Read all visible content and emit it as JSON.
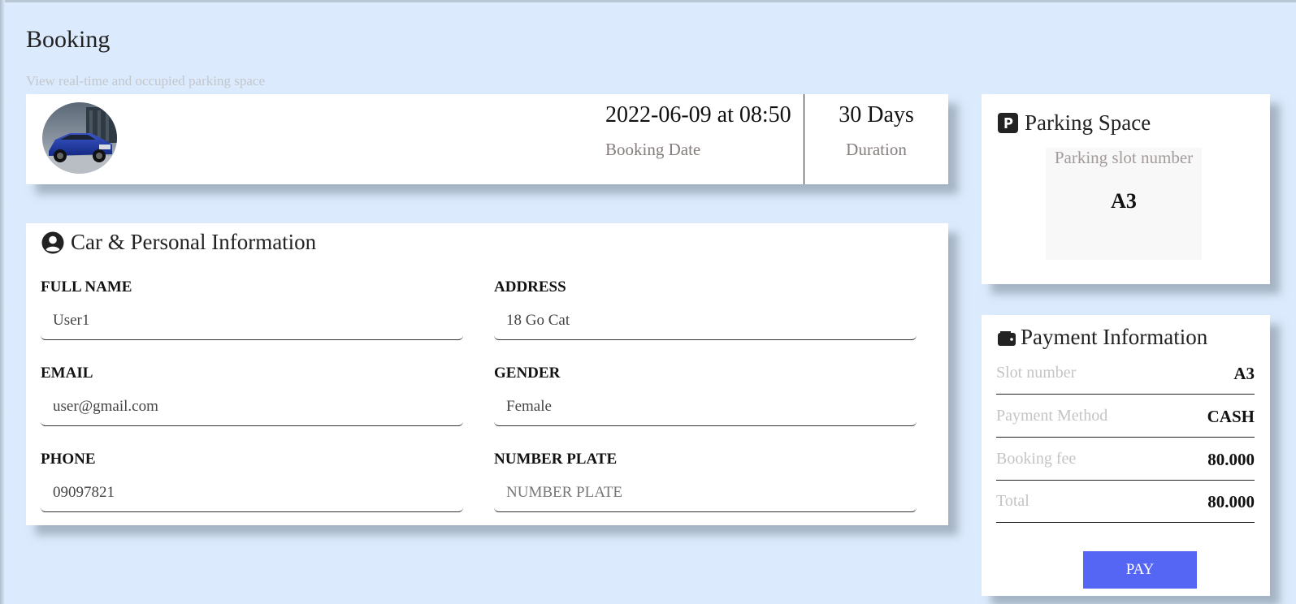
{
  "page": {
    "title": "Booking",
    "subtitle": "View real-time and occupied parking space"
  },
  "booking": {
    "date_value": "2022-06-09 at 08:50",
    "date_label": "Booking Date",
    "duration_value": "30 Days",
    "duration_label": "Duration"
  },
  "personal_info": {
    "heading": "Car & Personal Information",
    "icon": "user-circle-icon",
    "fields": {
      "full_name": {
        "label": "FULL NAME",
        "value": "User1",
        "placeholder": ""
      },
      "address": {
        "label": "ADDRESS",
        "value": "18 Go Cat",
        "placeholder": ""
      },
      "email": {
        "label": "EMAIL",
        "value": "user@gmail.com",
        "placeholder": ""
      },
      "gender": {
        "label": "GENDER",
        "value": "Female",
        "placeholder": ""
      },
      "phone": {
        "label": "PHONE",
        "value": "09097821",
        "placeholder": ""
      },
      "number_plate": {
        "label": "NUMBER PLATE",
        "value": "",
        "placeholder": "NUMBER PLATE"
      }
    }
  },
  "parking_space": {
    "heading": "Parking Space",
    "icon": "parking-icon",
    "slot_label": "Parking slot number",
    "slot_value": "A3"
  },
  "payment": {
    "heading": "Payment Information",
    "icon": "wallet-icon",
    "rows": [
      {
        "label": "Slot number",
        "value": "A3"
      },
      {
        "label": "Payment Method",
        "value": "CASH"
      },
      {
        "label": "Booking fee",
        "value": "80.000"
      },
      {
        "label": "Total",
        "value": "80.000"
      }
    ],
    "button_label": "PAY",
    "button_color": "#5566f5"
  },
  "colors": {
    "background": "#dbeafc",
    "card": "#ffffff"
  }
}
